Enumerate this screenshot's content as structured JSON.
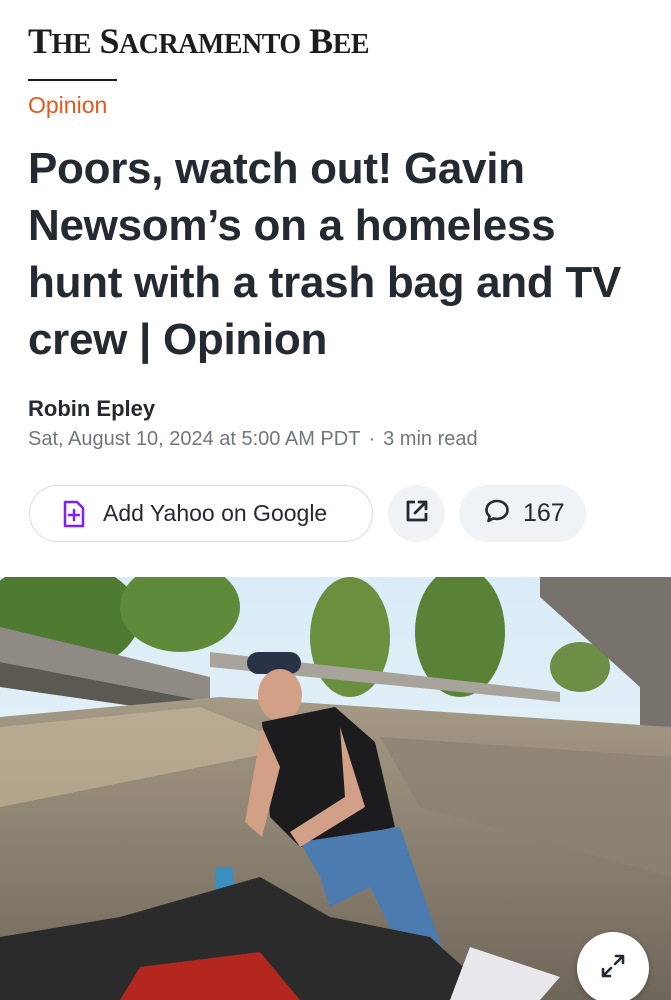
{
  "masthead": {
    "the": "T",
    "the_small": "HE",
    "sac": "S",
    "sac_small": "ACRAMENTO",
    "bee": "B",
    "bee_small": "EE"
  },
  "article": {
    "section": "Opinion",
    "headline": "Poors, watch out! Gavin Newsom’s on a homeless hunt with a trash bag and TV crew | Opinion",
    "author": "Robin Epley",
    "date": "Sat, August 10, 2024 at 5:00 AM PDT",
    "separator": "·",
    "read_time": "3 min read"
  },
  "actions": {
    "add_google_label": "Add Yahoo on Google",
    "add_google_icon": "plus-square-icon",
    "share_icon": "external-link-icon",
    "comments_icon": "speech-bubble-icon",
    "comments_count": "167",
    "expand_icon": "expand-arrows-icon"
  },
  "colors": {
    "section": "#e4591e",
    "text": "#232a31",
    "muted": "#6e7780",
    "accent_purple": "#7e1fff",
    "pill_bg": "#f0f3f5"
  }
}
